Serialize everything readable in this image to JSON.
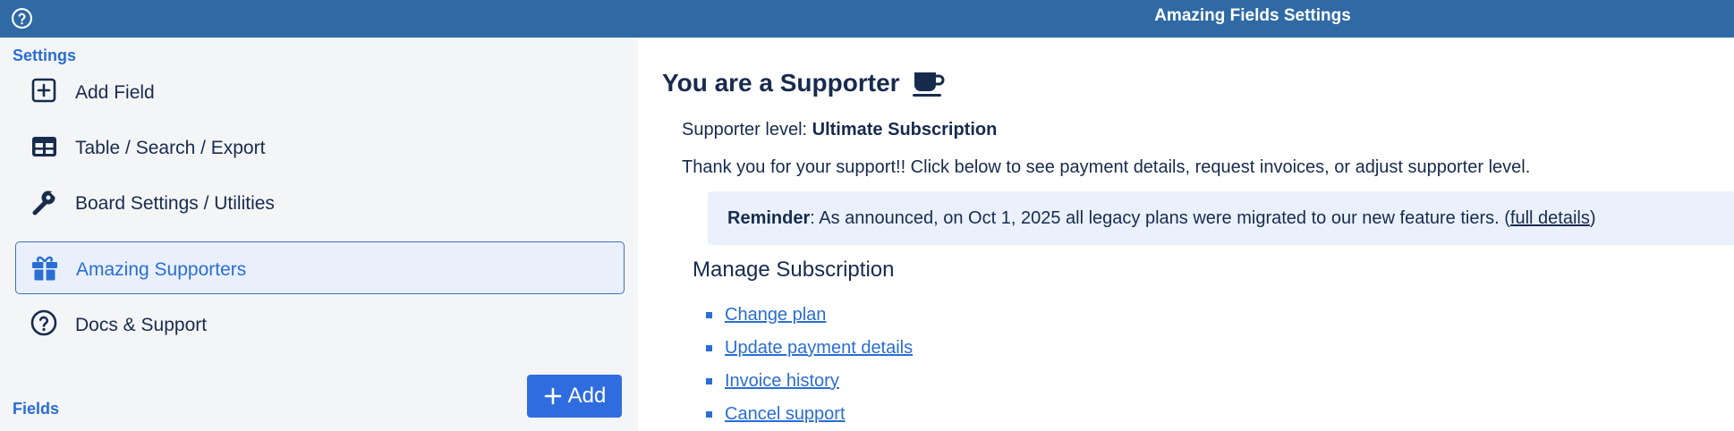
{
  "header": {
    "title": "Amazing Fields Settings",
    "help_icon": "question-circle-icon"
  },
  "sidebar": {
    "settings_title": "Settings",
    "items": [
      {
        "label": "Add Field",
        "icon": "plus-square-icon",
        "active": false
      },
      {
        "label": "Table / Search / Export",
        "icon": "table-icon",
        "active": false
      },
      {
        "label": "Board Settings / Utilities",
        "icon": "wrench-icon",
        "active": false
      },
      {
        "label": "Amazing Supporters",
        "icon": "gift-icon",
        "active": true
      },
      {
        "label": "Docs & Support",
        "icon": "question-circle-icon",
        "active": false
      }
    ],
    "fields_title": "Fields",
    "add_button_label": "Add"
  },
  "main": {
    "heading": "You are a Supporter",
    "heading_icon": "coffee-cup-icon",
    "level_label": "Supporter level:",
    "level_value": "Ultimate Subscription",
    "thanks": "Thank you for your support!! Click below to see payment details, request invoices, or adjust supporter level.",
    "reminder": {
      "bold": "Reminder",
      "text": ": As announced, on Oct 1, 2025 all legacy plans were migrated to our new feature tiers. (",
      "link": "full details",
      "end": ")"
    },
    "manage_title": "Manage Subscription",
    "links": [
      "Change plan",
      "Update payment details",
      "Invoice history",
      "Cancel support"
    ]
  },
  "colors": {
    "header_bg": "#2f6aa5",
    "accent": "#2a6dd3",
    "button": "#2f6ce0",
    "sidebar_bg": "#f4f5f7"
  }
}
